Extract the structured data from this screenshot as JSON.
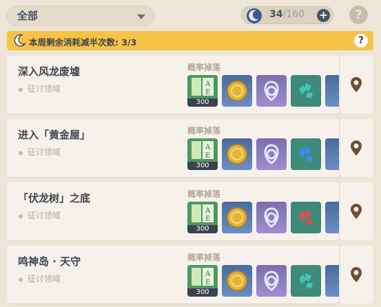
{
  "filter": {
    "label": "全部"
  },
  "resin": {
    "current": "34",
    "max": "/160",
    "add": "+"
  },
  "help_top": "?",
  "notice": {
    "text": "本周剩余消耗减半次数: 3/3",
    "help": "?"
  },
  "domains": [
    {
      "name": "深入风龙废墟",
      "type": "征讨领域",
      "drops_label": "概率掉落",
      "gem_color": "#3ec7b2",
      "count": "300"
    },
    {
      "name": "进入「黄金屋」",
      "type": "征讨领域",
      "drops_label": "概率掉落",
      "gem_color": "#3a8de8",
      "count": "300"
    },
    {
      "name": "「伏龙树」之底",
      "type": "征讨领域",
      "drops_label": "概率掉落",
      "gem_color": "#e04a4a",
      "count": "300"
    },
    {
      "name": "鸣神岛 · 天守",
      "type": "征讨领域",
      "drops_label": "概率掉落",
      "gem_color": "#3ec7b2",
      "count": "300"
    }
  ]
}
